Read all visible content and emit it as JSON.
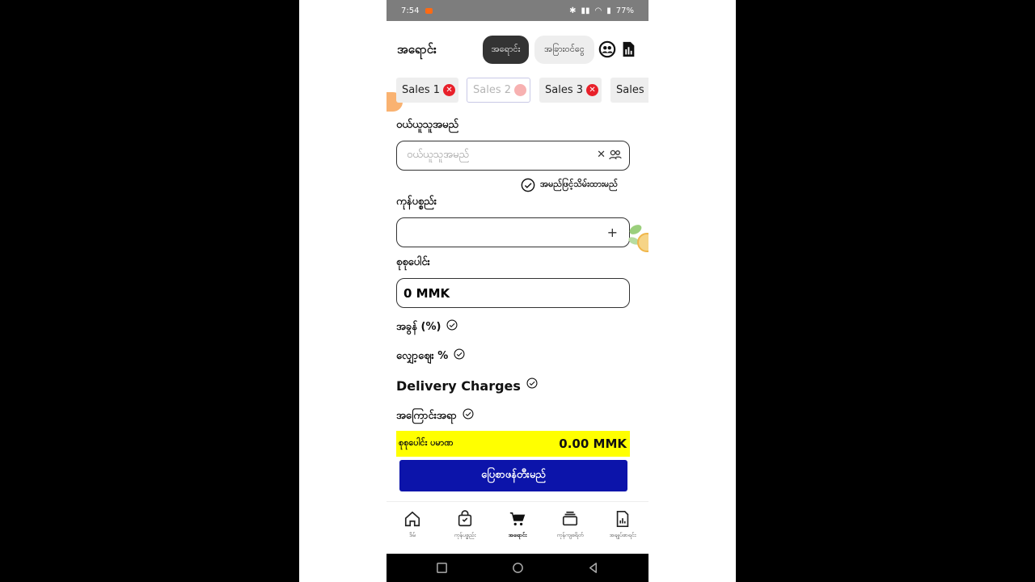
{
  "status_bar": {
    "time": "7:54",
    "battery": "77%"
  },
  "header": {
    "title": "အရောင်း",
    "toggle_active": "အရောင်း",
    "toggle_inactive": "အခြားဝင်ငွေ"
  },
  "tabs": [
    {
      "label": "Sales 1"
    },
    {
      "label": "Sales 2"
    },
    {
      "label": "Sales 3"
    },
    {
      "label": "Sales"
    }
  ],
  "customer": {
    "label": "ဝယ်ယူသူအမည်",
    "placeholder": "ဝယ်ယူသူအမည်",
    "save_label": "အမည်ဖြင့်သိမ်းထားမည်"
  },
  "products": {
    "label": "ကုန်ပစ္စည်း"
  },
  "total": {
    "label": "စုစုပေါင်း",
    "value": "0 MMK"
  },
  "options": {
    "discount": "အခွန် (%)",
    "reduction": "လျှော့ဈေး %",
    "delivery": "Delivery Charges",
    "note": "အကြောင်းအရာ"
  },
  "grand_total": {
    "label": "စုစုပေါင်း ပမာဏ",
    "value": "0.00 MMK"
  },
  "pay_button": "ပြေစာဖန်တီးမည်",
  "bottom_nav": [
    {
      "label": "ဒိမ်",
      "icon": "home-icon"
    },
    {
      "label": "ကုန်ပစ္စည်း",
      "icon": "bag-icon"
    },
    {
      "label": "အရောင်း",
      "icon": "cart-icon"
    },
    {
      "label": "ကုန်ကျစရိတ်",
      "icon": "wallet-icon"
    },
    {
      "label": "အချုပ်စာရင်း",
      "icon": "report-icon"
    }
  ],
  "colors": {
    "accent_blue": "#0c14aa",
    "total_yellow": "#ffff00",
    "close_red": "#e8202a"
  }
}
